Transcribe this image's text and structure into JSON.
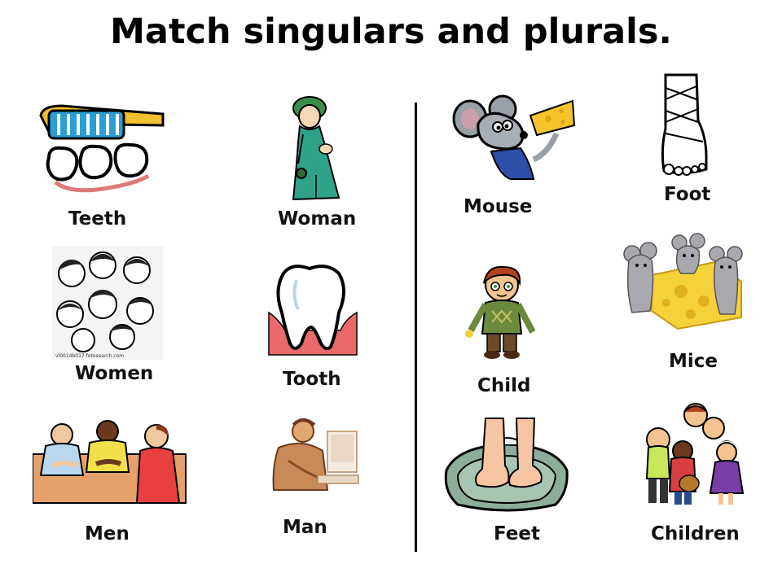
{
  "title": "Match singulars and plurals.",
  "words": {
    "teeth": "Teeth",
    "woman": "Woman",
    "mouse": "Mouse",
    "foot": "Foot",
    "women": "Women",
    "tooth": "Tooth",
    "child": "Child",
    "mice": "Mice",
    "men": "Men",
    "man": "Man",
    "feet": "Feet",
    "children": "Children"
  },
  "watermark": "vl0014b017 fotosearch.com"
}
